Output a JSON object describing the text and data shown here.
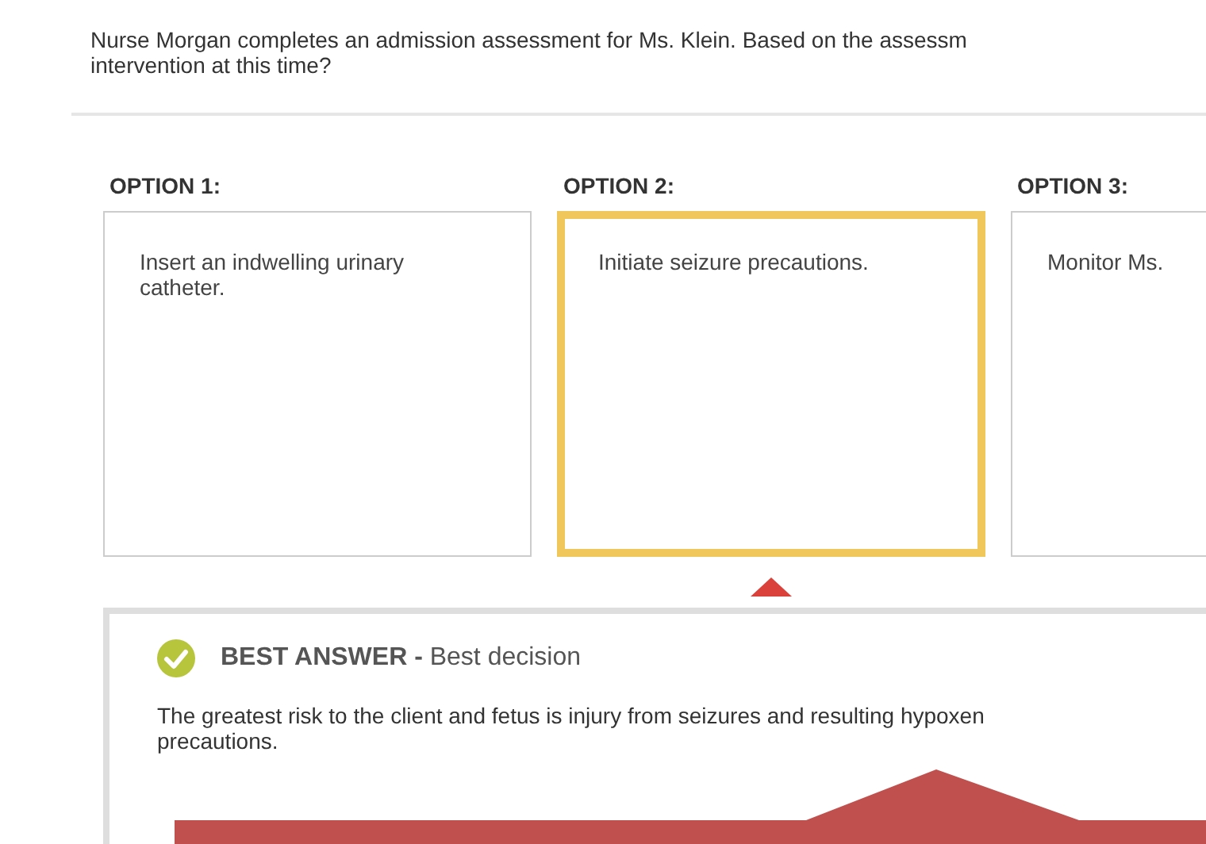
{
  "question": {
    "lines": [
      "Nurse Morgan completes an admission assessment for Ms. Klein. Based on the assessm",
      "intervention at this time?"
    ]
  },
  "options": [
    {
      "heading": "OPTION 1:",
      "text": "Insert an indwelling urinary catheter.",
      "selected": false
    },
    {
      "heading": "OPTION 2:",
      "text": "Initiate seizure precautions.",
      "selected": true
    },
    {
      "heading": "OPTION 3:",
      "text": "Monitor Ms.",
      "selected": false
    }
  ],
  "feedback": {
    "verdict": "**BEST ANSWER -** Best decision",
    "correct": true,
    "lines": [
      "The greatest risk to the client and fetus is injury from seizures and resulting hypoxen",
      "precautions."
    ]
  }
}
